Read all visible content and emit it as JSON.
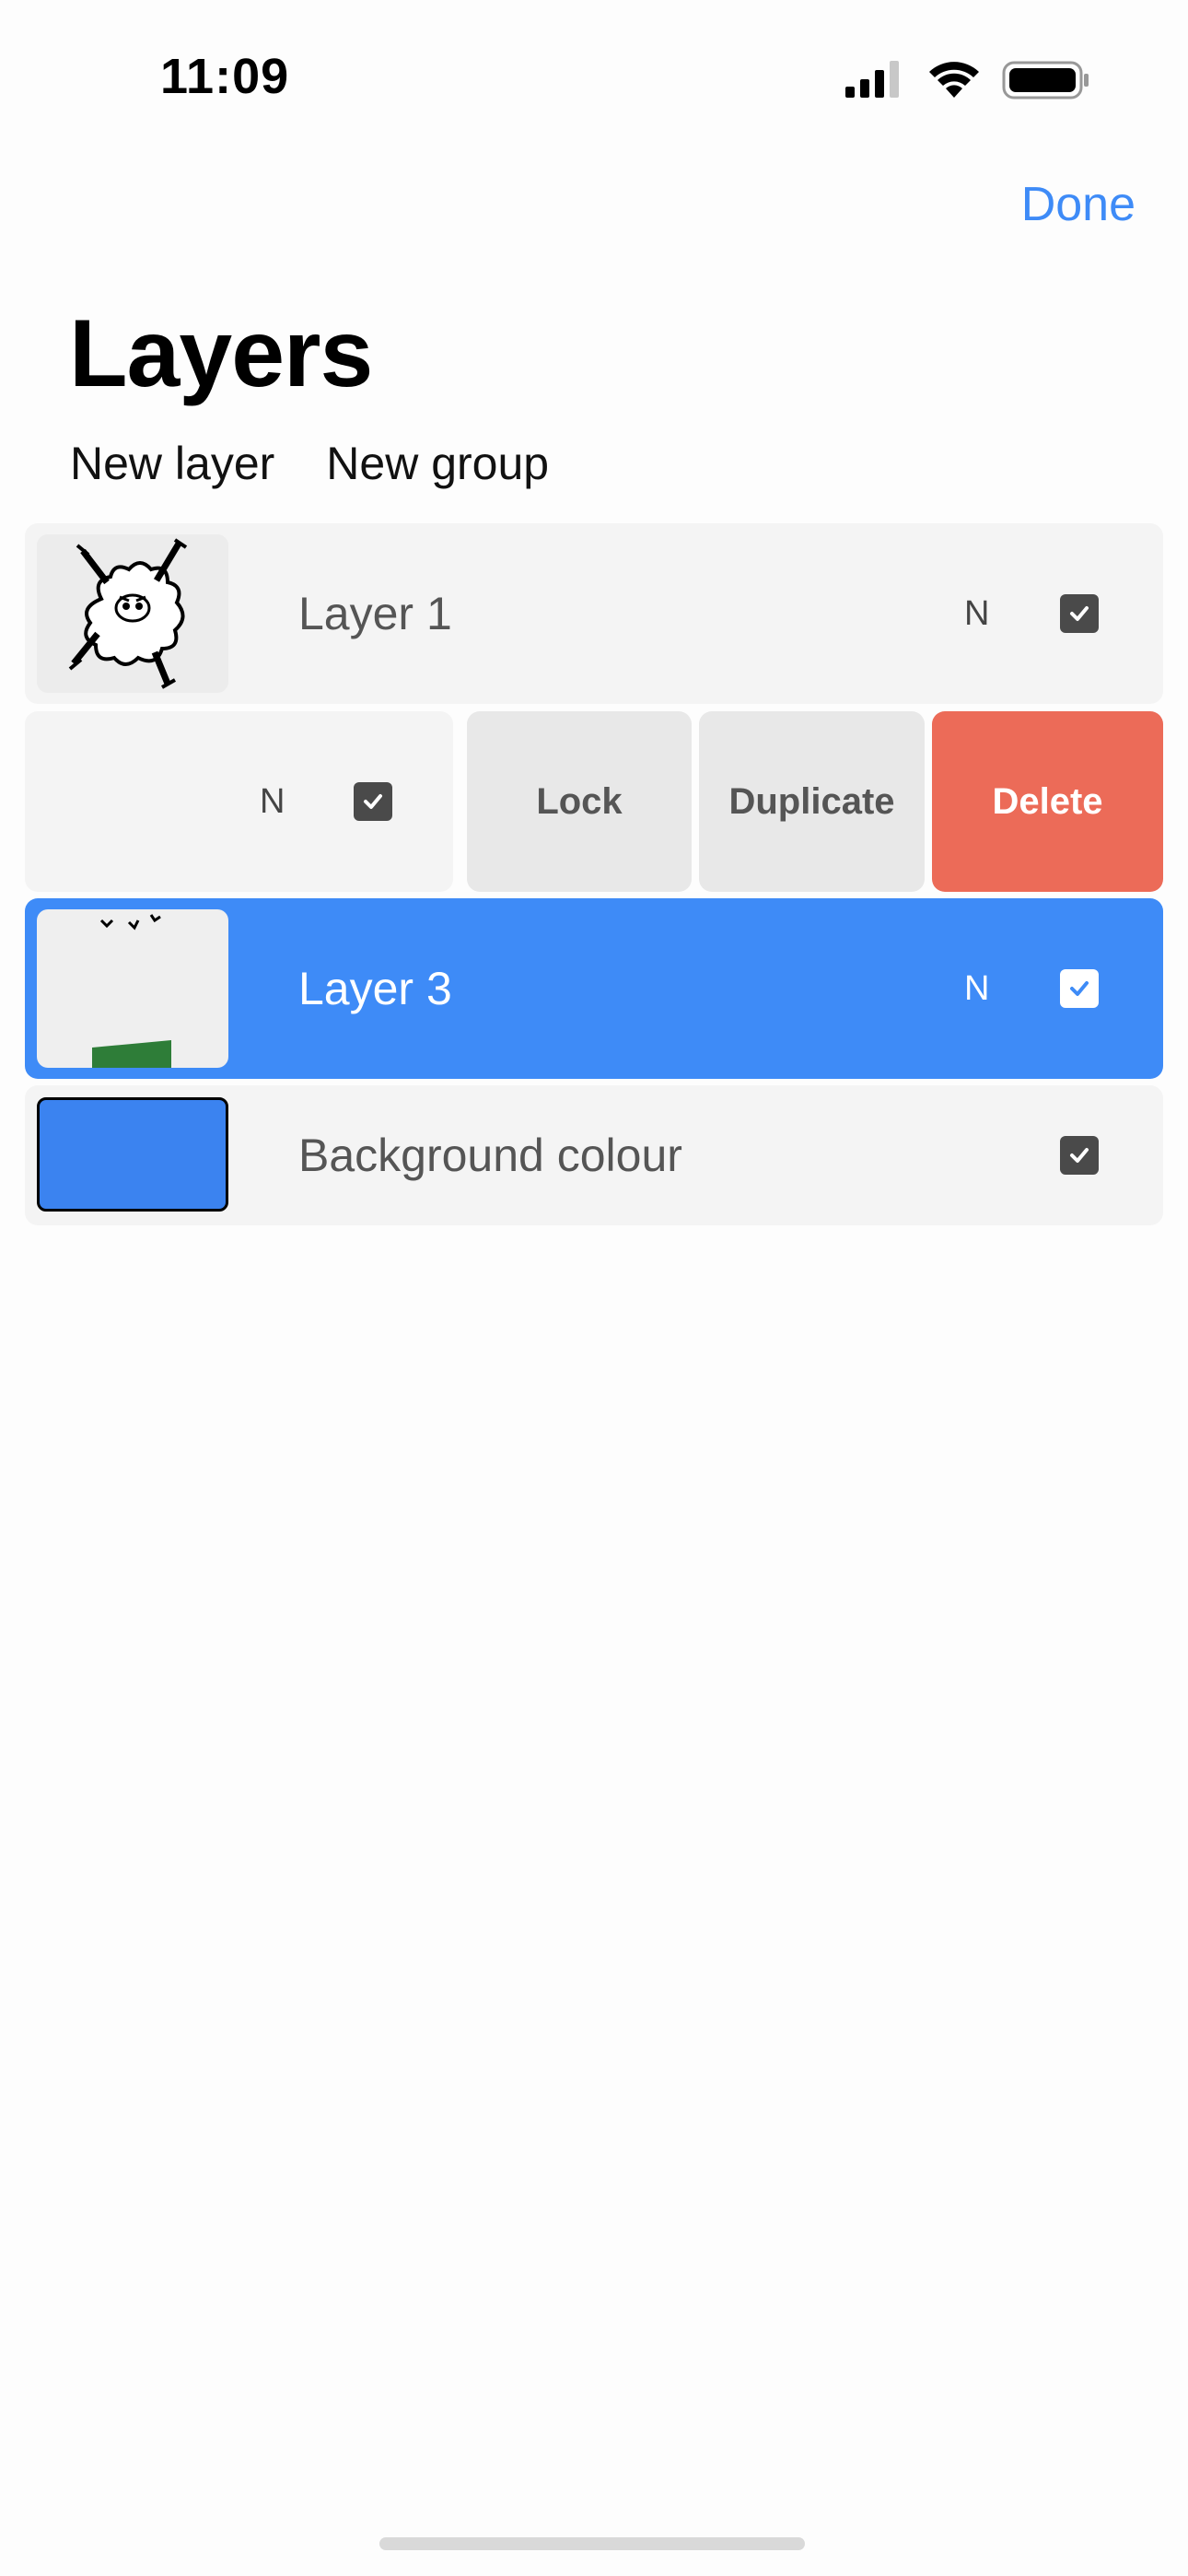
{
  "status_bar": {
    "time": "11:09"
  },
  "header": {
    "done_label": "Done",
    "title": "Layers"
  },
  "toolbar": {
    "new_layer_label": "New layer",
    "new_group_label": "New group"
  },
  "layers": [
    {
      "name": "Layer 1",
      "blend_mode": "N",
      "visible": true,
      "selected": false,
      "thumbnail": "sheep-drawing"
    },
    {
      "name": "",
      "blend_mode": "N",
      "visible": true,
      "selected": false,
      "swiped": true
    },
    {
      "name": "Layer 3",
      "blend_mode": "N",
      "visible": true,
      "selected": true,
      "thumbnail": "landscape-drawing"
    },
    {
      "name": "Background colour",
      "visible": true,
      "swatch_color": "#3b83f0"
    }
  ],
  "swipe_actions": {
    "lock_label": "Lock",
    "duplicate_label": "Duplicate",
    "delete_label": "Delete"
  },
  "colors": {
    "accent": "#3e8bf7",
    "delete": "#ec6b58",
    "selected_row": "#3e8bf7"
  }
}
